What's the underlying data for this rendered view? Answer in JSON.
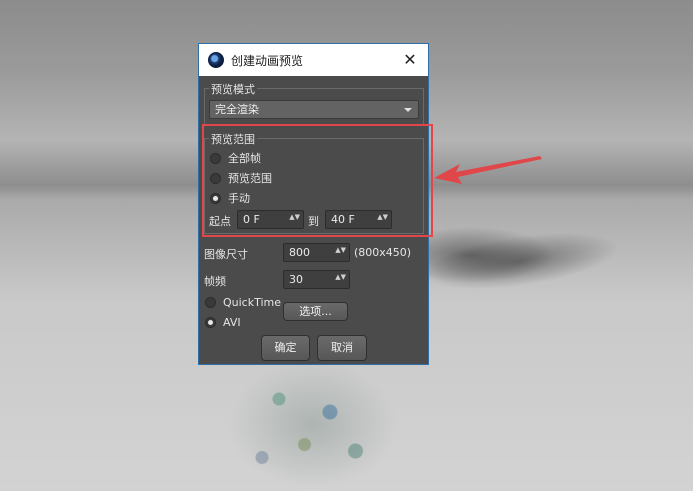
{
  "dialog": {
    "title": "创建动画预览",
    "close_glyph": "✕"
  },
  "preview_mode": {
    "legend": "预览模式",
    "selected": "完全渲染"
  },
  "preview_range": {
    "legend": "预览范围",
    "options": [
      {
        "label": "全部帧",
        "selected": false
      },
      {
        "label": "预览范围",
        "selected": false
      },
      {
        "label": "手动",
        "selected": true
      }
    ],
    "start_label": "起点",
    "start_value": "0 F",
    "to_label": "到",
    "end_value": "40 F"
  },
  "image_size": {
    "label": "图像尺寸",
    "value": "800",
    "dims": "(800x450)"
  },
  "frame_rate": {
    "label": "帧频",
    "value": "30"
  },
  "format": {
    "options": [
      {
        "label": "QuickTime",
        "selected": false
      },
      {
        "label": "AVI",
        "selected": true
      }
    ],
    "options_button": "选项..."
  },
  "buttons": {
    "ok": "确定",
    "cancel": "取消"
  },
  "spinner_glyph": "▲▼",
  "colors": {
    "dialog_bg": "#4b4b4b",
    "highlight": "#e0474b",
    "annotation_arrow": "#e0474b"
  }
}
